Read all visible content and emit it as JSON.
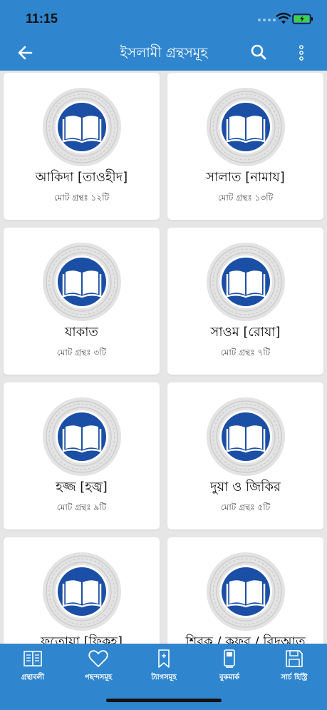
{
  "status": {
    "time": "11:15"
  },
  "header": {
    "title": "ইসলামী গ্রন্থসমূহ"
  },
  "colors": {
    "primary": "#2f86cf",
    "emblem": "#1b4fa6"
  },
  "icons": [
    "back-arrow-icon",
    "search-icon",
    "more-vertical-icon",
    "open-book-icon"
  ],
  "categories": [
    {
      "title": "আকিদা [তাওহীদ]",
      "count": "মোট গ্রন্থঃ ১২টি"
    },
    {
      "title": "সালাত [নামায]",
      "count": "মোট গ্রন্থঃ ১৩টি"
    },
    {
      "title": "যাকাত",
      "count": "মোট গ্রন্থঃ ৩টি"
    },
    {
      "title": "সাওম [রোযা]",
      "count": "মোট গ্রন্থঃ ৭টি"
    },
    {
      "title": "হজ্জ [হজ্ব]",
      "count": "মোট গ্রন্থঃ ৯টি"
    },
    {
      "title": "দুয়া ও জিকির",
      "count": "মোট গ্রন্থঃ ৫টি"
    },
    {
      "title": "ফতোয়া [ফিকহ]",
      "count": ""
    },
    {
      "title": "শিরক / কুফর / বিদআত",
      "count": ""
    }
  ],
  "tabs": [
    {
      "label": "গ্রন্থাবলী",
      "icon": "book-icon"
    },
    {
      "label": "পছন্দসমূহ",
      "icon": "heart-icon"
    },
    {
      "label": "ট্যাগসমূহ",
      "icon": "tag-icon"
    },
    {
      "label": "বুকমার্ক",
      "icon": "bookmark-icon"
    },
    {
      "label": "সার্চ হিস্ট্রি",
      "icon": "save-icon"
    }
  ]
}
